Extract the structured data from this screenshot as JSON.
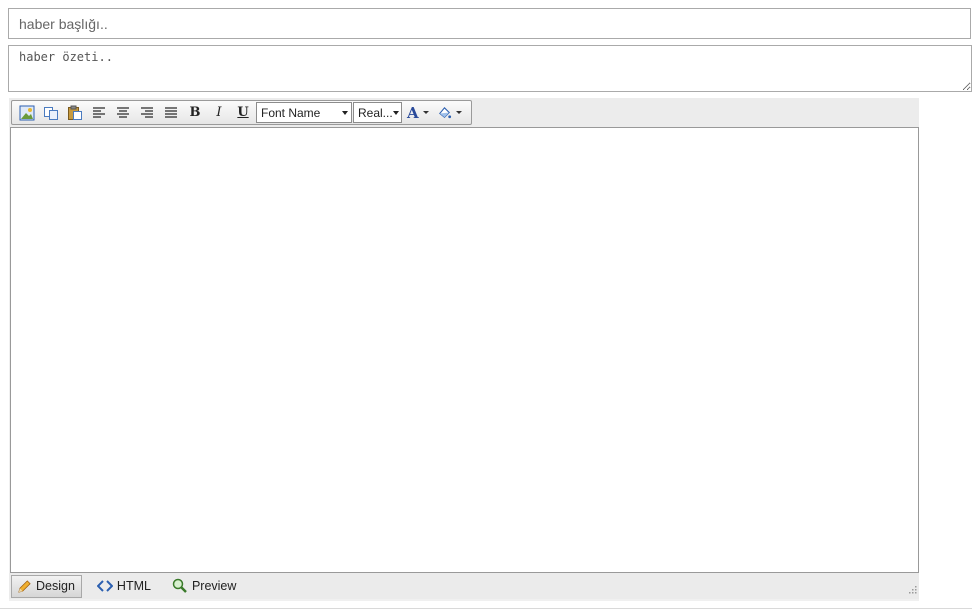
{
  "form": {
    "title_placeholder": "haber başlığı..",
    "title_value": "",
    "summary_placeholder": "haber özeti..",
    "summary_value": ""
  },
  "toolbar": {
    "bold_label": "B",
    "italic_label": "I",
    "underline_label": "U",
    "font_name": "Font Name",
    "font_size": "Real...",
    "font_color_label": "A",
    "icons": [
      "insert-image-icon",
      "copy-icon",
      "paste-icon",
      "align-left-icon",
      "align-center-icon",
      "align-right-icon",
      "align-justify-icon",
      "font-color-icon",
      "background-color-icon"
    ]
  },
  "modes": {
    "design_label": "Design",
    "html_label": "HTML",
    "preview_label": "Preview",
    "active": "Design"
  },
  "colors": {
    "border": "#aaaaaa",
    "toolbar_bg": "#ececec",
    "font_color": "#2a4a9a"
  }
}
